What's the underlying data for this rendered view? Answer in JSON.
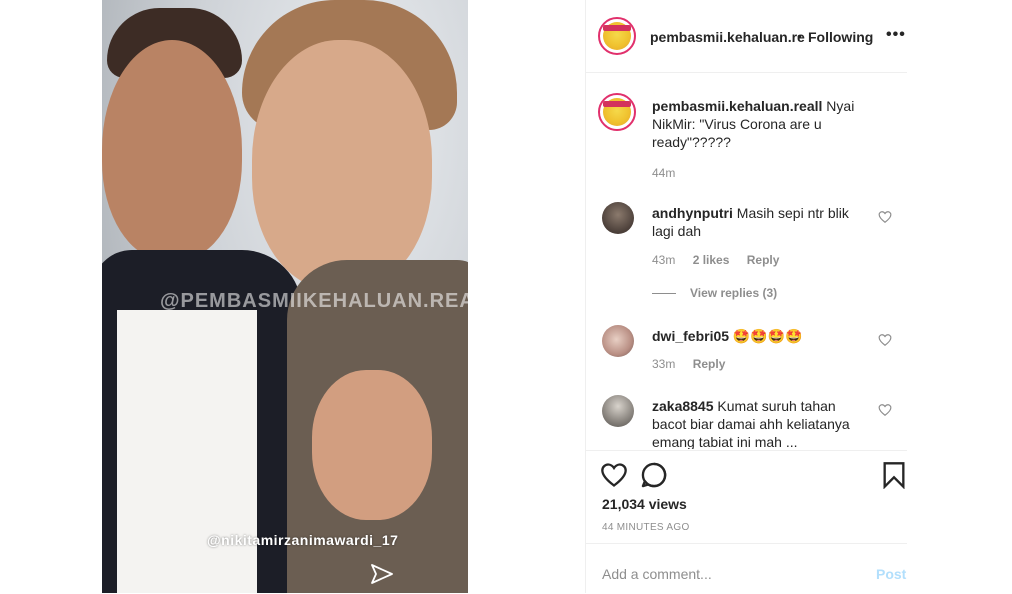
{
  "post": {
    "watermark": "@PEMBASMIIKEHALUAN.REAL",
    "mention": "@nikitamirzanimawardi_17"
  },
  "header": {
    "username": "pembasmii.kehaluan.re",
    "separator": "•",
    "follow_status": "Following",
    "more": "•••"
  },
  "caption": {
    "username": "pembasmii.kehaluan.reall",
    "text": " Nyai NikMir: \"Virus Corona are u ready\"?????",
    "time": "44m"
  },
  "comments": [
    {
      "username": "andhynputri",
      "text": " Masih sepi ntr blik lagi dah",
      "time": "43m",
      "likes": "2 likes",
      "reply": "Reply",
      "view_replies": "View replies (3)"
    },
    {
      "username": "dwi_febri05",
      "text": " 🤩🤩🤩🤩",
      "time": "33m",
      "reply": "Reply"
    },
    {
      "username": "zaka8845",
      "text": " Kumat suruh tahan bacot biar damai ahh keliatanya emang tabiat ini mah ..."
    }
  ],
  "stats": {
    "views": "21,034 views",
    "posted": "44 MINUTES AGO"
  },
  "composer": {
    "placeholder": "Add a comment...",
    "post_label": "Post"
  },
  "colors": {
    "accent": "#e1306c",
    "post_disabled": "#b2dffc",
    "muted": "#8e8e8e",
    "text": "#262626"
  }
}
